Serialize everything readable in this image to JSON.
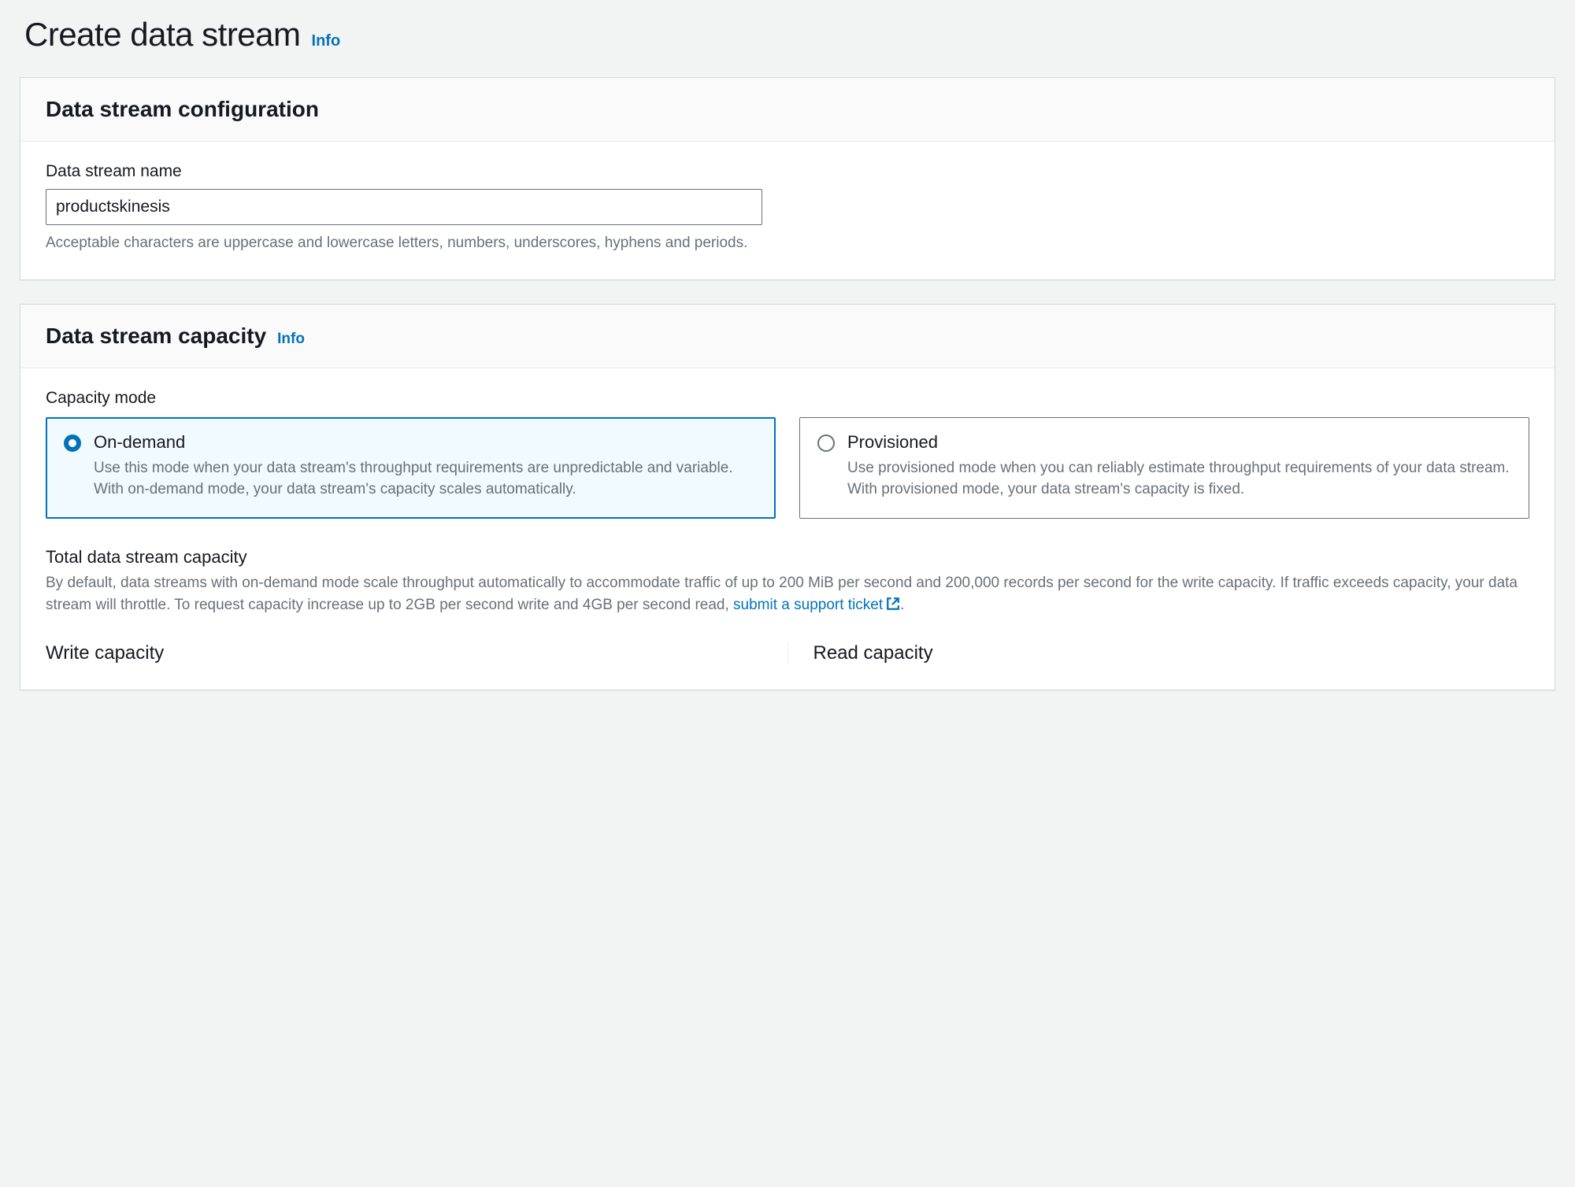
{
  "header": {
    "title": "Create data stream",
    "info_label": "Info"
  },
  "config_panel": {
    "title": "Data stream configuration",
    "name_label": "Data stream name",
    "name_value": "productskinesis",
    "name_help": "Acceptable characters are uppercase and lowercase letters, numbers, underscores, hyphens and periods."
  },
  "capacity_panel": {
    "title": "Data stream capacity",
    "info_label": "Info",
    "mode_label": "Capacity mode",
    "options": [
      {
        "title": "On-demand",
        "description": "Use this mode when your data stream's throughput requirements are unpredictable and variable. With on-demand mode, your data stream's capacity scales automatically.",
        "selected": true
      },
      {
        "title": "Provisioned",
        "description": "Use provisioned mode when you can reliably estimate throughput requirements of your data stream. With provisioned mode, your data stream's capacity is fixed.",
        "selected": false
      }
    ],
    "total": {
      "title": "Total data stream capacity",
      "description_prefix": "By default, data streams with on-demand mode scale throughput automatically to accommodate traffic of up to 200 MiB per second and 200,000 records per second for the write capacity. If traffic exceeds capacity, your data stream will throttle. To request capacity increase up to 2GB per second write and 4GB per second read, ",
      "link_text": "submit a support ticket",
      "description_suffix": "."
    },
    "write_capacity_title": "Write capacity",
    "read_capacity_title": "Read capacity"
  }
}
